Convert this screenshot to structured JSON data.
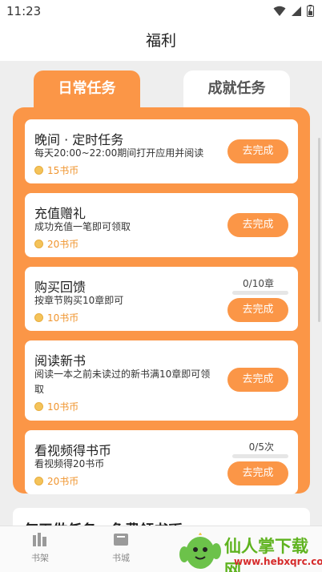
{
  "status_bar": {
    "time": "11:23"
  },
  "header": {
    "title": "福利"
  },
  "tabs": [
    {
      "label": "日常任务",
      "active": true
    },
    {
      "label": "成就任务",
      "active": false
    }
  ],
  "tasks": [
    {
      "title": "晚间 · 定时任务",
      "desc": "每天20:00~22:00期间打开应用并阅读",
      "reward": "15书币",
      "button": "去完成"
    },
    {
      "title": "充值赠礼",
      "desc": "成功充值一笔即可领取",
      "reward": "20书币",
      "button": "去完成"
    },
    {
      "title": "购买回馈",
      "desc": "按章节购买10章即可",
      "reward": "10书币",
      "button": "去完成",
      "progress_text": "0/10章",
      "progress": 0
    },
    {
      "title": "阅读新书",
      "desc": "阅读一本之前未读过的新书满10章即可领取",
      "reward": "10书币",
      "button": "去完成"
    },
    {
      "title": "看视频得书币",
      "desc": "看视频得20书币",
      "reward": "20书币",
      "button": "去完成",
      "progress_text": "0/5次",
      "progress": 0
    }
  ],
  "section": {
    "title": "每天做任务，免费领书币"
  },
  "bottom_nav": [
    {
      "label": "书架",
      "icon": "bookshelf-icon"
    },
    {
      "label": "书城",
      "icon": "bookstore-icon"
    }
  ],
  "watermark": {
    "text": "仙人掌下载网",
    "url": "www.hebxqrc.com"
  },
  "colors": {
    "accent": "#fb9647",
    "reward": "#f0952f",
    "background": "#eeeeee"
  }
}
